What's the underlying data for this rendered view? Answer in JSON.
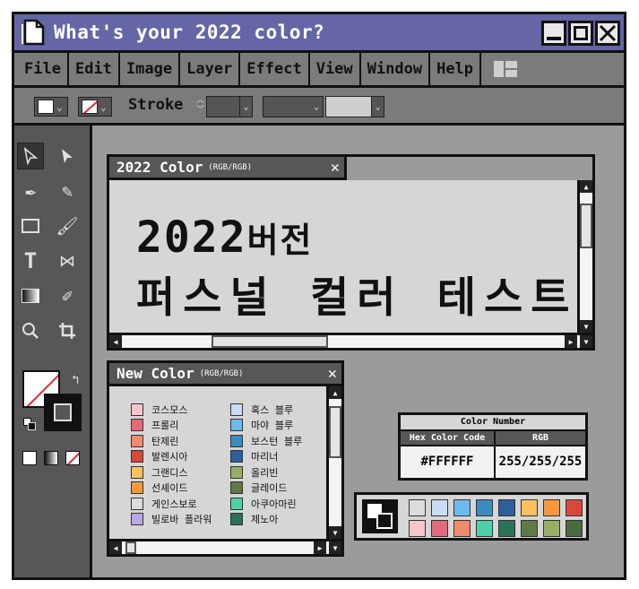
{
  "window": {
    "title": "What's your 2022 color?"
  },
  "menu": [
    "File",
    "Edit",
    "Image",
    "Layer",
    "Effect",
    "View",
    "Window",
    "Help"
  ],
  "toolbar": {
    "stroke_label": "Stroke"
  },
  "tools": [
    "selection-arrow",
    "direct-selection-arrow",
    "pen",
    "curvature-pen",
    "rectangle",
    "paintbrush",
    "type",
    "width",
    "gradient",
    "eyedropper",
    "zoom",
    "crop"
  ],
  "color_window": {
    "title": "2022 Color",
    "title_note": "(RGB/RGB)",
    "line1_number": "2022",
    "line1_suffix": "버전",
    "line2": "퍼스널 컬러 테스트"
  },
  "new_color_window": {
    "title": "New Color",
    "title_note": "(RGB/RGB)",
    "left": [
      {
        "name": "코스모스",
        "color": "#f7c6cc"
      },
      {
        "name": "프롤리",
        "color": "#e56a7a"
      },
      {
        "name": "탄제린",
        "color": "#f28a6c"
      },
      {
        "name": "발렌시아",
        "color": "#d9473b"
      },
      {
        "name": "그랜디스",
        "color": "#f9c25e"
      },
      {
        "name": "선셰이드",
        "color": "#f7983c"
      },
      {
        "name": "게인스보로",
        "color": "#dcdcdc"
      },
      {
        "name": "빌로바 플라워",
        "color": "#b9a8e8"
      }
    ],
    "right": [
      {
        "name": "혹스 블루",
        "color": "#c8dcf7"
      },
      {
        "name": "마야 블루",
        "color": "#6db9ee"
      },
      {
        "name": "보스턴 블루",
        "color": "#3c8cc0"
      },
      {
        "name": "마리너",
        "color": "#2f5e9c"
      },
      {
        "name": "올리빈",
        "color": "#97ae64"
      },
      {
        "name": "글레이드",
        "color": "#5e7a45"
      },
      {
        "name": "아쿠아마린",
        "color": "#4fcfa8"
      },
      {
        "name": "제노아",
        "color": "#2b7256"
      }
    ]
  },
  "color_number": {
    "title": "Color Number",
    "hex_label": "Hex Color Code",
    "rgb_label": "RGB",
    "hex": "#FFFFFF",
    "rgb": "255/255/255"
  },
  "palette": {
    "row1": [
      "#dcdcdc",
      "#c8dcf7",
      "#6db9ee",
      "#3c8cc0",
      "#2f5e9c",
      "#f9c25e",
      "#f7983c",
      "#d9473b"
    ],
    "row2": [
      "#f7c6cc",
      "#e56a7a",
      "#f28a6c",
      "#4fcfa8",
      "#2b7256",
      "#5e7a45",
      "#97ae64",
      "#4a6b3b"
    ]
  }
}
